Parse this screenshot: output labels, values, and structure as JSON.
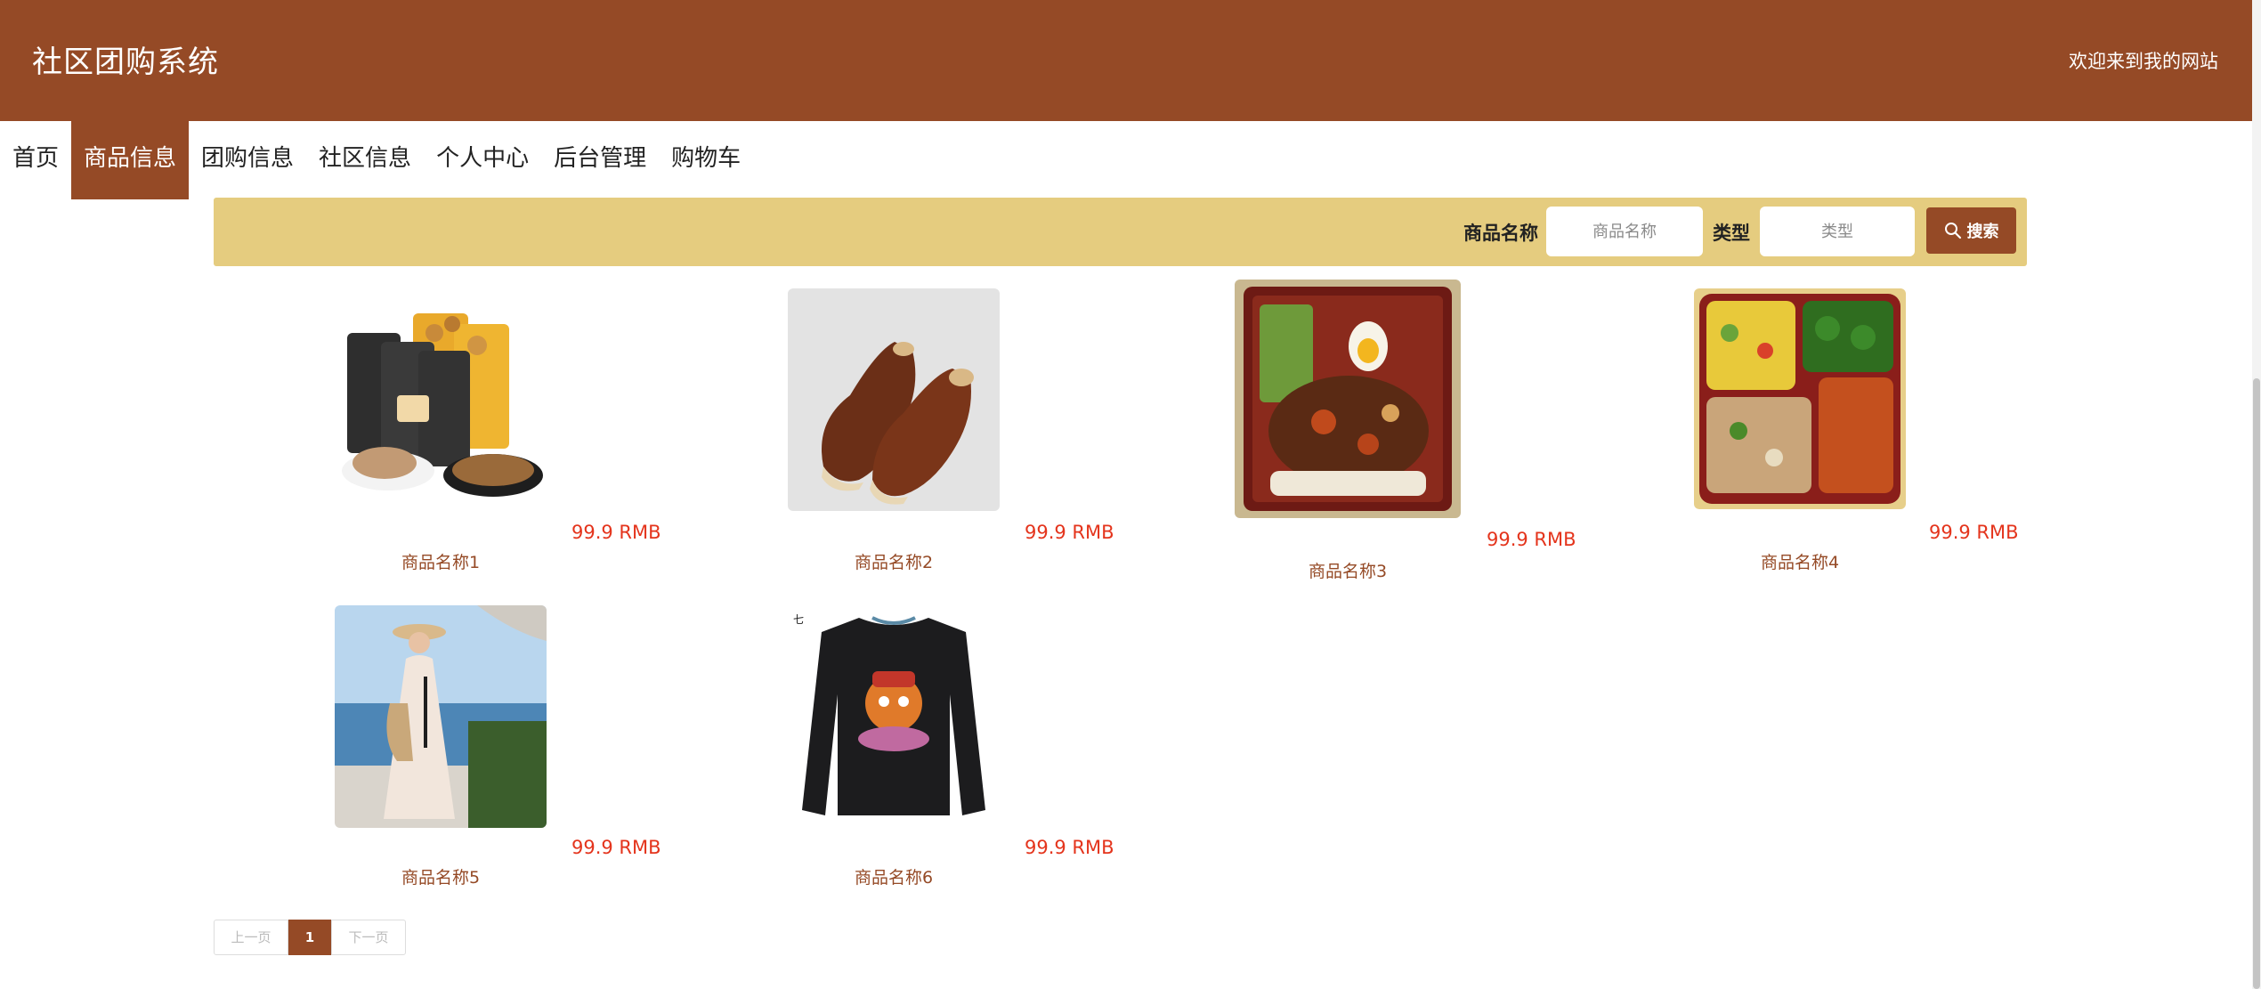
{
  "header": {
    "title": "社区团购系统",
    "welcome": "欢迎来到我的网站"
  },
  "nav": {
    "items": [
      {
        "label": "首页"
      },
      {
        "label": "商品信息",
        "active": true
      },
      {
        "label": "团购信息"
      },
      {
        "label": "社区信息"
      },
      {
        "label": "个人中心"
      },
      {
        "label": "后台管理"
      },
      {
        "label": "购物车"
      }
    ]
  },
  "search": {
    "name_label": "商品名称",
    "name_placeholder": "商品名称",
    "type_label": "类型",
    "type_placeholder": "类型",
    "button_label": "搜索"
  },
  "products": [
    {
      "name": "商品名称1",
      "price": "99.9 RMB",
      "image": "snack-packs"
    },
    {
      "name": "商品名称2",
      "price": "99.9 RMB",
      "image": "brown-leather-shoes"
    },
    {
      "name": "商品名称3",
      "price": "99.9 RMB",
      "image": "bento-box-rice"
    },
    {
      "name": "商品名称4",
      "price": "99.9 RMB",
      "image": "bento-box-vegetables"
    },
    {
      "name": "商品名称5",
      "price": "99.9 RMB",
      "image": "woman-beach-dress"
    },
    {
      "name": "商品名称6",
      "price": "99.9 RMB",
      "image": "black-cartoon-sweatshirt"
    }
  ],
  "pagination": {
    "prev": "上一页",
    "current": "1",
    "next": "下一页"
  },
  "colors": {
    "brand": "#954a26",
    "search_bar": "#e5cc7f",
    "price": "#e4341c"
  }
}
